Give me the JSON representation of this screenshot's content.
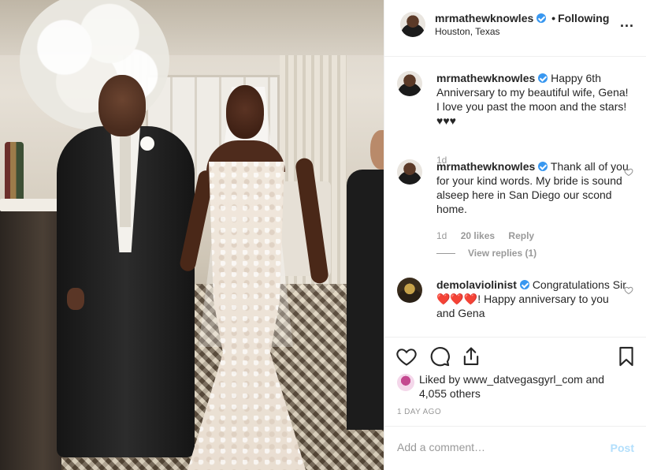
{
  "post_image": {
    "alt": ""
  },
  "header": {
    "username": "mrmathewknowles",
    "separator": "•",
    "follow_label": "Following",
    "location": "Houston, Texas",
    "more_label": "..."
  },
  "comments": [
    {
      "username": "mrmathewknowles",
      "text": "Happy 6th Anniversary to my beautiful wife, Gena! I love you past the moon and the stars! ♥♥♥",
      "time": "1d"
    },
    {
      "username": "mrmathewknowles",
      "text": "Thank all of you for your kind words. My bride is sound alseep here in San Diego our scond home.",
      "time": "1d",
      "likes": "20 likes",
      "reply_label": "Reply",
      "view_replies": "View replies (1)"
    },
    {
      "username": "demolaviolinist",
      "text": "Congratulations Sir ❤️❤️❤️! Happy anniversary to you and Gena"
    }
  ],
  "likes": {
    "prefix": "Liked by ",
    "user": "www_datvegasgyrl_com",
    "middle": " and ",
    "count": "4,055 others"
  },
  "time_ago": "1 DAY AGO",
  "add_comment": {
    "placeholder": "Add a comment…",
    "post_label": "Post"
  },
  "colors": {
    "verified": "#3897f0",
    "post_button": "#b2dffc",
    "secondary_text": "#999999"
  }
}
